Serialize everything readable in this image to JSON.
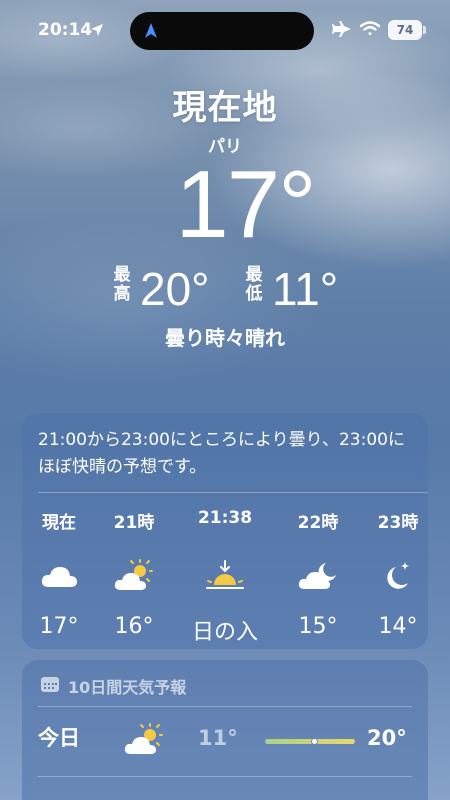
{
  "status_bar": {
    "time": "20:14",
    "battery": "74"
  },
  "header": {
    "location_title": "現在地",
    "city": "パリ",
    "current_temp": "17°",
    "high_label": "最高",
    "high_value": "20°",
    "low_label": "最低",
    "low_value": "11°",
    "condition": "曇り時々晴れ"
  },
  "hourly": {
    "summary": "21:00から23:00にところにより曇り、23:00にほぼ快晴の予想です。",
    "items": [
      {
        "time": "現在",
        "icon": "cloud-icon",
        "temp": "17°"
      },
      {
        "time": "21時",
        "icon": "partly-sunny-icon",
        "temp": "16°"
      },
      {
        "time": "21:38",
        "icon": "sunset-icon",
        "temp": "日の入"
      },
      {
        "time": "22時",
        "icon": "partly-cloudy-night-icon",
        "temp": "15°"
      },
      {
        "time": "23時",
        "icon": "clear-night-icon",
        "temp": "14°"
      }
    ]
  },
  "forecast": {
    "header": "10日間天気予報",
    "days": [
      {
        "day": "今日",
        "icon": "partly-sunny-icon",
        "low": "11°",
        "high": "20°",
        "current_level": 0.55
      }
    ]
  },
  "colors": {
    "bar_low": "#a9d28b",
    "bar_high": "#e8d66a",
    "sun": "#f6c945"
  }
}
